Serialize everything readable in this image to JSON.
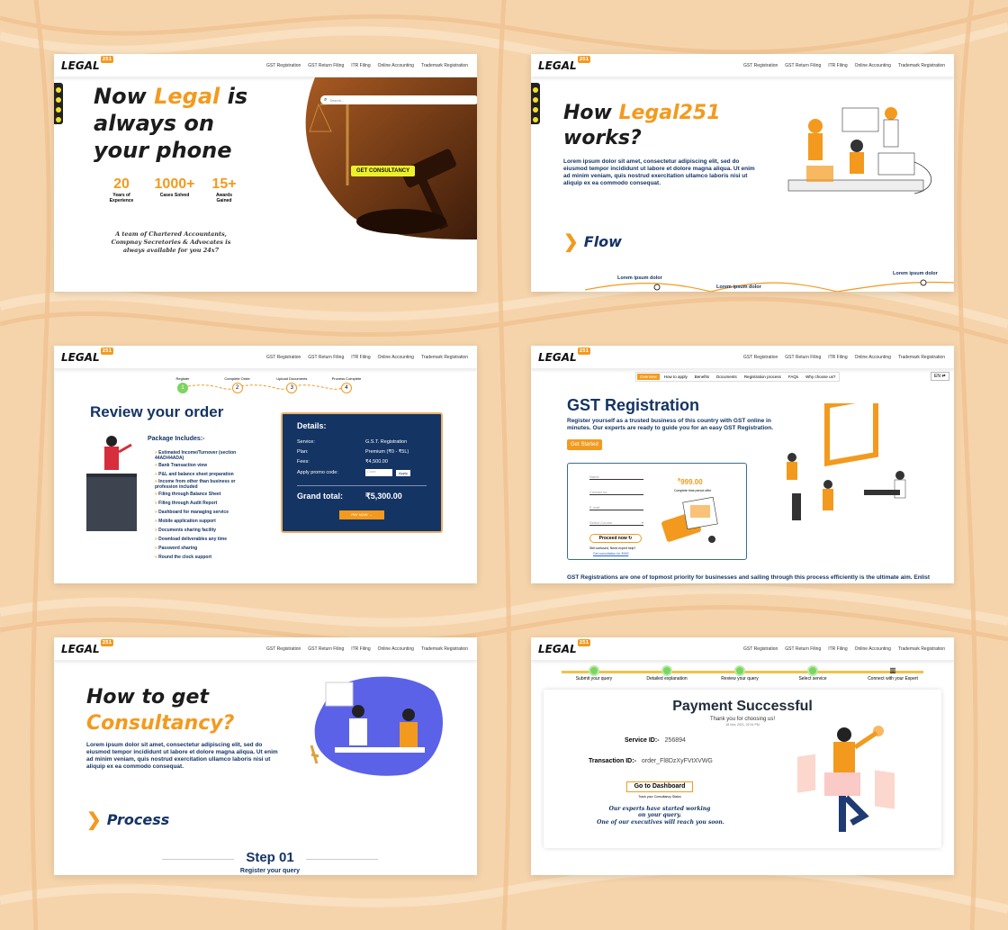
{
  "nav": {
    "logo": "LEGAL",
    "logo_badge": "251",
    "links": [
      "GST Registration",
      "GST Return Filing",
      "ITR Filing",
      "Online Accounting",
      "Trademark Registration"
    ]
  },
  "card1": {
    "h1": "Now",
    "h2": "Legal",
    "h3": "is",
    "h4": "always on",
    "h5": "your phone",
    "stats": [
      {
        "v": "20",
        "l": "Years of Experience"
      },
      {
        "v": "1000+",
        "l": "Cases Solved"
      },
      {
        "v": "15+",
        "l": "Awards Gained"
      }
    ],
    "quote": "A team of Chartered Accountants, Compnay Secretories & Advocates is always available for you 24x7",
    "search_placeholder": "Search...",
    "cta": "GET CONSULTANCY"
  },
  "card2": {
    "h1": "How",
    "h2": "Legal251",
    "h3": "works?",
    "body": "Lorem ipsum dolor sit amet, consectetur adipiscing elit, sed do eiusmod tempor incididunt ut labore et dolore magna aliqua. Ut enim ad minim veniam, quis nostrud exercitation ullamco laboris nisi ut aliquip ex ea commodo consequat.",
    "flow": "Flow",
    "points": [
      "Lorem ipsum dolor",
      "Lorem ipsum dolor",
      "Lorem ipsum dolor"
    ]
  },
  "card3": {
    "steps": [
      "Register",
      "Complete Order",
      "Upload Documents",
      "Process Complete"
    ],
    "step_nums": [
      "1",
      "2",
      "3",
      "4"
    ],
    "title": "Review your order",
    "pkg_title": "Package Includes:-",
    "pkg": [
      "Estimated Income/Turnover (section 44AD/44ADA)",
      "Bank Transaction view",
      "P&L and balance sheet preparation",
      "Income from other than business or profession included",
      "Filing through Balance Sheet",
      "Filing through Audit Report",
      "Dashboard for managing service",
      "Mobile application support",
      "Documents sharing facility",
      "Download deliverables any time",
      "Password sharing",
      "Round the clock support"
    ],
    "details_title": "Details:",
    "rows": [
      {
        "k": "Service:",
        "v": "G.S.T. Registration"
      },
      {
        "k": "Plan:",
        "v": "Premium (₹0 - ₹5L)"
      },
      {
        "k": "Fees:",
        "v": "₹4,500.00"
      }
    ],
    "promo_label": "Apply promo code:",
    "promo_placeholder": "Code",
    "apply": "Apply",
    "total_label": "Grand total:",
    "total": "₹5,300.00",
    "paynow": "PAY NOW →"
  },
  "card4": {
    "tabs": [
      "Overview",
      "How to apply",
      "Benefits",
      "Documents",
      "Registration process",
      "FAQs",
      "Why choose us?"
    ],
    "lang": "EN ⇄",
    "title": "GST Registration",
    "sub": "Register yourself as a trusted business of this country with GST online in minutes. Our experts are ready to guide you for an easy GST Registration.",
    "cta": "Get Started",
    "fields": [
      "Name",
      "Contact no.",
      "E-mail",
      "Select Course"
    ],
    "price": "999.00",
    "price_sym": "₹",
    "price_note": "Complete time period offer",
    "proceed": "Proceed now ↻",
    "help1": "Still confused, Need expert help?",
    "help2": "Get consultation for ₹999",
    "foot": "GST Registrations are one of topmost priority for businesses and sailing through this process efficiently is the ultimate aim. Enlist"
  },
  "card5": {
    "h1": "How to get",
    "h2": "Consultancy?",
    "body": "Lorem ipsum dolor sit amet, consectetur adipiscing elit, sed do eiusmod tempor incididunt ut labore et dolore magna aliqua. Ut enim ad minim veniam, quis nostrud exercitation ullamco laboris nisi ut aliquip ex ea commodo consequat.",
    "process": "Process",
    "step": "Step 01",
    "step_sub": "Register your query"
  },
  "card6": {
    "steps": [
      "Submit your query",
      "Detailed explanation",
      "Review your query",
      "Select service",
      "Connect with your Expert"
    ],
    "title": "Payment Successful",
    "thanks": "Thank you for choosing us!",
    "date": "18 Nov, 2021, 02:31 PM",
    "sid_label": "Service ID:-",
    "sid": "256894",
    "tid_label": "Transaction ID:-",
    "tid": "order_Fl8DzXyFVtXVWG",
    "dash": "Go to Dashboard",
    "track": "Track your Consultancy Status",
    "msg1": "Our experts have started working on your query.",
    "msg2": "One of our executives will reach you soon."
  },
  "colors": {
    "orange": "#f39a1e",
    "navy": "#143464",
    "bg": "#f6d4ab"
  }
}
